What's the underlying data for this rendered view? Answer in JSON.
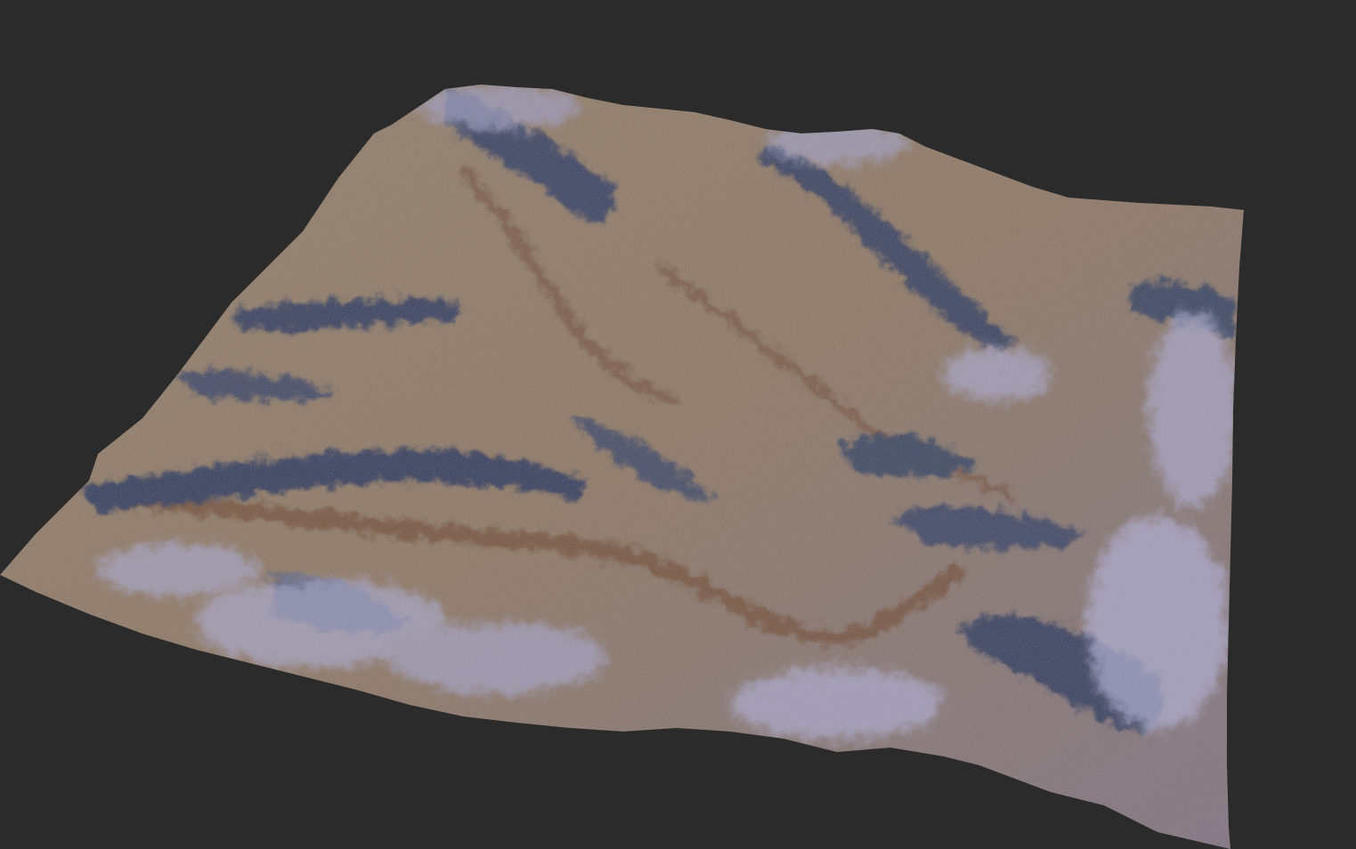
{
  "viewport": {
    "background_color": "#2b2b2b"
  },
  "terrain": {
    "subject": "terrain-heightmap-render",
    "base_color": "#8a7868",
    "ridge_shadow_color": "#3c4560",
    "highlight_color": "#a6a6c8",
    "valley_color": "#7a5a44"
  }
}
